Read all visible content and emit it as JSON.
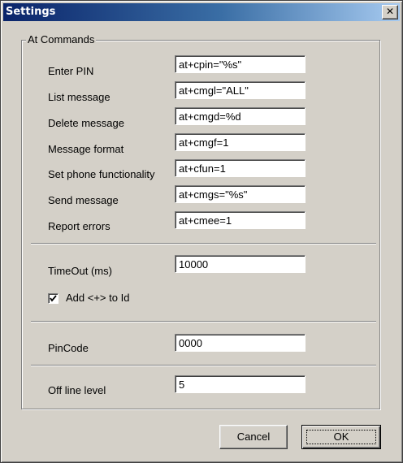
{
  "window": {
    "title": "Settings",
    "close_glyph": "✕"
  },
  "group": {
    "label": "At Commands"
  },
  "at_commands": [
    {
      "label": "Enter PIN",
      "value": "at+cpin=\"%s\""
    },
    {
      "label": "List message",
      "value": "at+cmgl=\"ALL\""
    },
    {
      "label": "Delete message",
      "value": "at+cmgd=%d"
    },
    {
      "label": "Message format",
      "value": "at+cmgf=1"
    },
    {
      "label": "Set phone functionality",
      "value": "at+cfun=1"
    },
    {
      "label": "Send message",
      "value": "at+cmgs=\"%s\""
    },
    {
      "label": "Report errors",
      "value": "at+cmee=1"
    }
  ],
  "timeout": {
    "label": "TimeOut (ms)",
    "value": "10000"
  },
  "add_plus": {
    "label": "Add <+> to Id",
    "checked": true
  },
  "pincode": {
    "label": "PinCode",
    "value": "0000"
  },
  "offline": {
    "label": "Off line level",
    "value": "5"
  },
  "buttons": {
    "cancel": "Cancel",
    "ok": "OK"
  },
  "icons": {
    "close": "close-icon",
    "check": "checkmark-icon"
  }
}
